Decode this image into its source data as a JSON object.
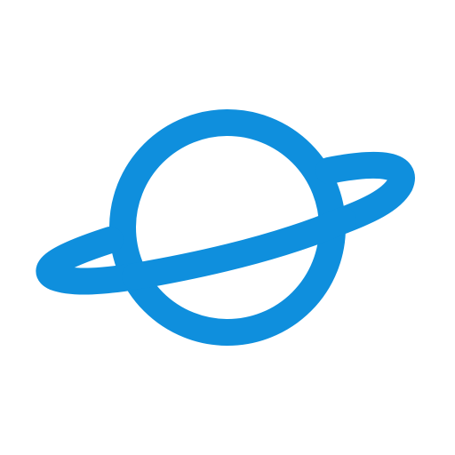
{
  "icon": {
    "name": "planet-icon",
    "color": "#0f8fdd",
    "background": "#ffffff"
  }
}
